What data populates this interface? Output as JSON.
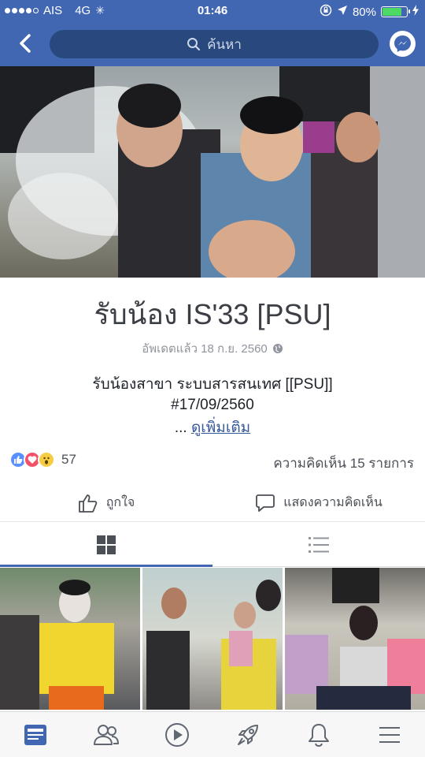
{
  "status": {
    "carrier": "AIS",
    "network": "4G",
    "time": "01:46",
    "battery": "80%",
    "battery_level": 0.8
  },
  "nav": {
    "search_placeholder": "ค้นหา"
  },
  "page": {
    "title": "รับน้อง IS'33 [PSU]",
    "updated": "อัพเดตแล้ว 18 ก.ย. 2560",
    "description_line1": "รับน้องสาขา ระบบสารสนเทศ [[PSU]]",
    "description_line2": "#17/09/2560",
    "more_prefix": "...",
    "more_link": "ดูเพิ่มเติม"
  },
  "engagement": {
    "reaction_count": "57",
    "comments": "ความคิดเห็น 15 รายการ",
    "like_label": "ถูกใจ",
    "comment_label": "แสดงความคิดเห็น"
  },
  "colors": {
    "brand": "#4267b2",
    "link": "#365899"
  }
}
